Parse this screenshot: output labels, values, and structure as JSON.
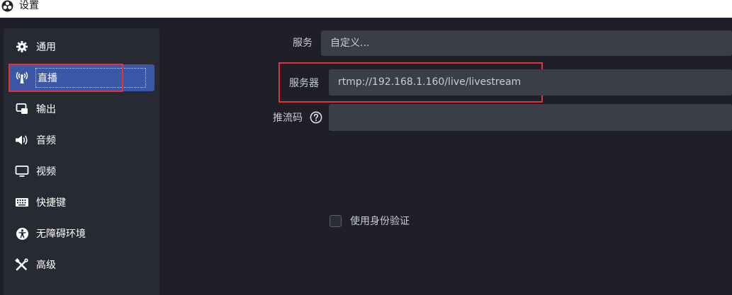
{
  "window": {
    "title": "设置",
    "logo_icon": "obs-logo-icon"
  },
  "sidebar": {
    "items": [
      {
        "label": "通用",
        "icon": "gear-icon",
        "selected": false
      },
      {
        "label": "直播",
        "icon": "broadcast-antenna-icon",
        "selected": true
      },
      {
        "label": "输出",
        "icon": "output-icon",
        "selected": false
      },
      {
        "label": "音频",
        "icon": "speaker-icon",
        "selected": false
      },
      {
        "label": "视频",
        "icon": "monitor-icon",
        "selected": false
      },
      {
        "label": "快捷键",
        "icon": "keyboard-icon",
        "selected": false
      },
      {
        "label": "无障碍环境",
        "icon": "accessibility-icon",
        "selected": false
      },
      {
        "label": "高级",
        "icon": "tools-icon",
        "selected": false
      }
    ]
  },
  "stream": {
    "service_label": "服务",
    "service_value": "自定义...",
    "server_label": "服务器",
    "server_value": "rtmp://192.168.1.160/live/livestream",
    "key_label": "推流码",
    "key_value": "",
    "auth_label": "使用身份验证",
    "auth_checked": false
  },
  "colors": {
    "background": "#1e1f29",
    "sidebar": "#272a33",
    "selected": "#3b57a6",
    "field": "#3b3e49",
    "annotation": "#e0323a"
  }
}
